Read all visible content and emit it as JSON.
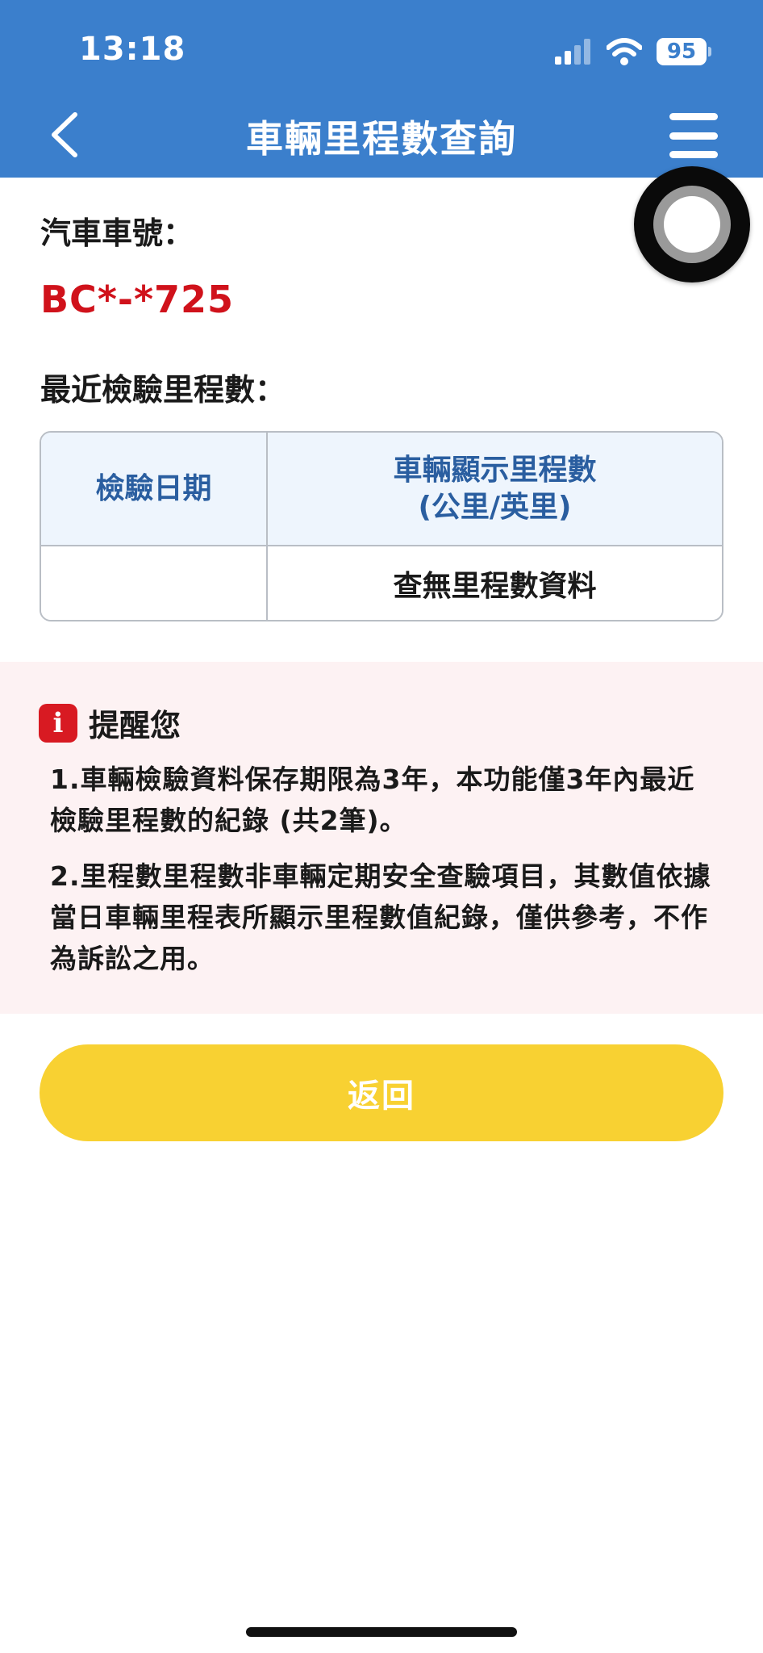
{
  "status_bar": {
    "time": "13:18",
    "battery": "95"
  },
  "nav": {
    "title": "車輛里程數查詢"
  },
  "vehicle": {
    "plate_label": "汽車車號：",
    "plate_number": "BC*-*725"
  },
  "mileage": {
    "section_label": "最近檢驗里程數：",
    "table": {
      "headers": [
        "檢驗日期",
        "車輛顯示里程數\n(公里/英里)"
      ],
      "rows": [
        [
          "",
          "查無里程數資料"
        ]
      ]
    }
  },
  "notice": {
    "title": "提醒您",
    "items": [
      "1.車輛檢驗資料保存期限為3年，本功能僅3年內最近檢驗里程數的紀錄 (共2筆)。",
      "2.里程數里程數非車輛定期安全查驗項目，其數值依據當日車輛里程表所顯示里程數值紀錄，僅供參考，不作為訴訟之用。"
    ]
  },
  "actions": {
    "back_label": "返回"
  },
  "colors": {
    "header": "#3b7fcc",
    "plate": "#d0121b",
    "table_header_text": "#2a5ea0",
    "notice_bg": "#fdf2f3",
    "info_icon": "#d81a22",
    "back_button": "#f8d132"
  },
  "icons": {
    "back": "chevron-left-icon",
    "menu": "hamburger-menu-icon",
    "info": "info-icon",
    "signal": "cellular-signal-icon",
    "wifi": "wifi-icon",
    "battery": "battery-icon",
    "floating": "assistive-touch-icon"
  }
}
